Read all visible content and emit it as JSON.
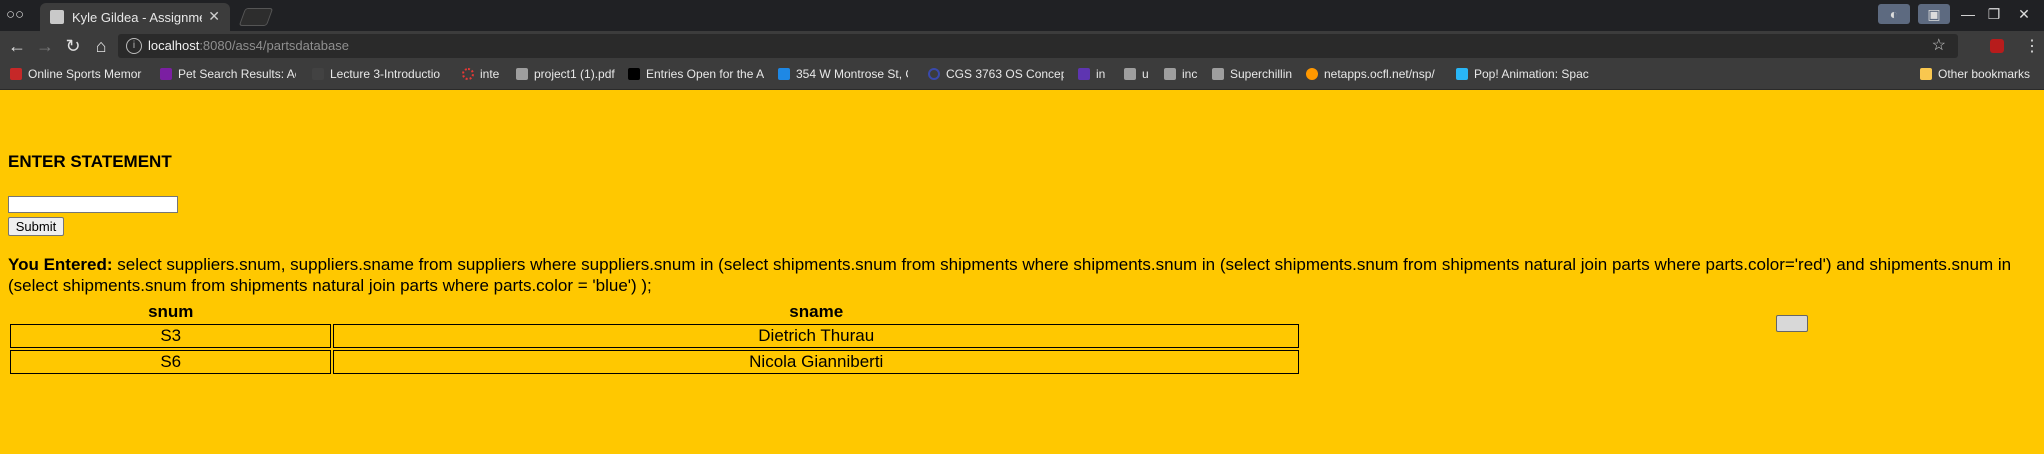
{
  "browser": {
    "tab_title": "Kyle Gildea - Assignment",
    "url_host": "localhost",
    "url_path": ":8080/ass4/partsdatabase"
  },
  "bookmarks": [
    {
      "label": "Online Sports Memor",
      "color": "#c62828"
    },
    {
      "label": "Pet Search Results: Ac",
      "color": "#7b1fa2"
    },
    {
      "label": "Lecture 3-Introductio",
      "color": "#424242"
    },
    {
      "label": "inte",
      "color": "#e53935"
    },
    {
      "label": "project1 (1).pdf",
      "color": "#9e9e9e"
    },
    {
      "label": "Entries Open for the A",
      "color": "#000000"
    },
    {
      "label": "354 W Montrose St, C",
      "color": "#1e88e5"
    },
    {
      "label": "CGS 3763 OS Concep",
      "color": "#3949ab"
    },
    {
      "label": "in",
      "color": "#5e35b1"
    },
    {
      "label": "u",
      "color": "#9e9e9e"
    },
    {
      "label": "inc",
      "color": "#9e9e9e"
    },
    {
      "label": "Superchillin",
      "color": "#9e9e9e"
    },
    {
      "label": "netapps.ocfl.net/nsp/",
      "color": "#ff9800"
    },
    {
      "label": "Pop! Animation: Spac",
      "color": "#29b6f6"
    }
  ],
  "other_bookmarks": "Other bookmarks",
  "page": {
    "heading": "ENTER STATEMENT",
    "submit_label": "Submit",
    "entered_label": "You Entered:",
    "entered_text": " select suppliers.snum, suppliers.sname from suppliers where suppliers.snum in (select shipments.snum from shipments where shipments.snum in (select shipments.snum from shipments natural join parts where parts.color='red') and shipments.snum in (select shipments.snum from shipments natural join parts where parts.color = 'blue') );",
    "columns": [
      "snum",
      "sname"
    ],
    "rows": [
      [
        "S3",
        "Dietrich Thurau"
      ],
      [
        "S6",
        "Nicola Gianniberti"
      ]
    ]
  },
  "colors": {
    "page_bg": "#ffc800"
  }
}
